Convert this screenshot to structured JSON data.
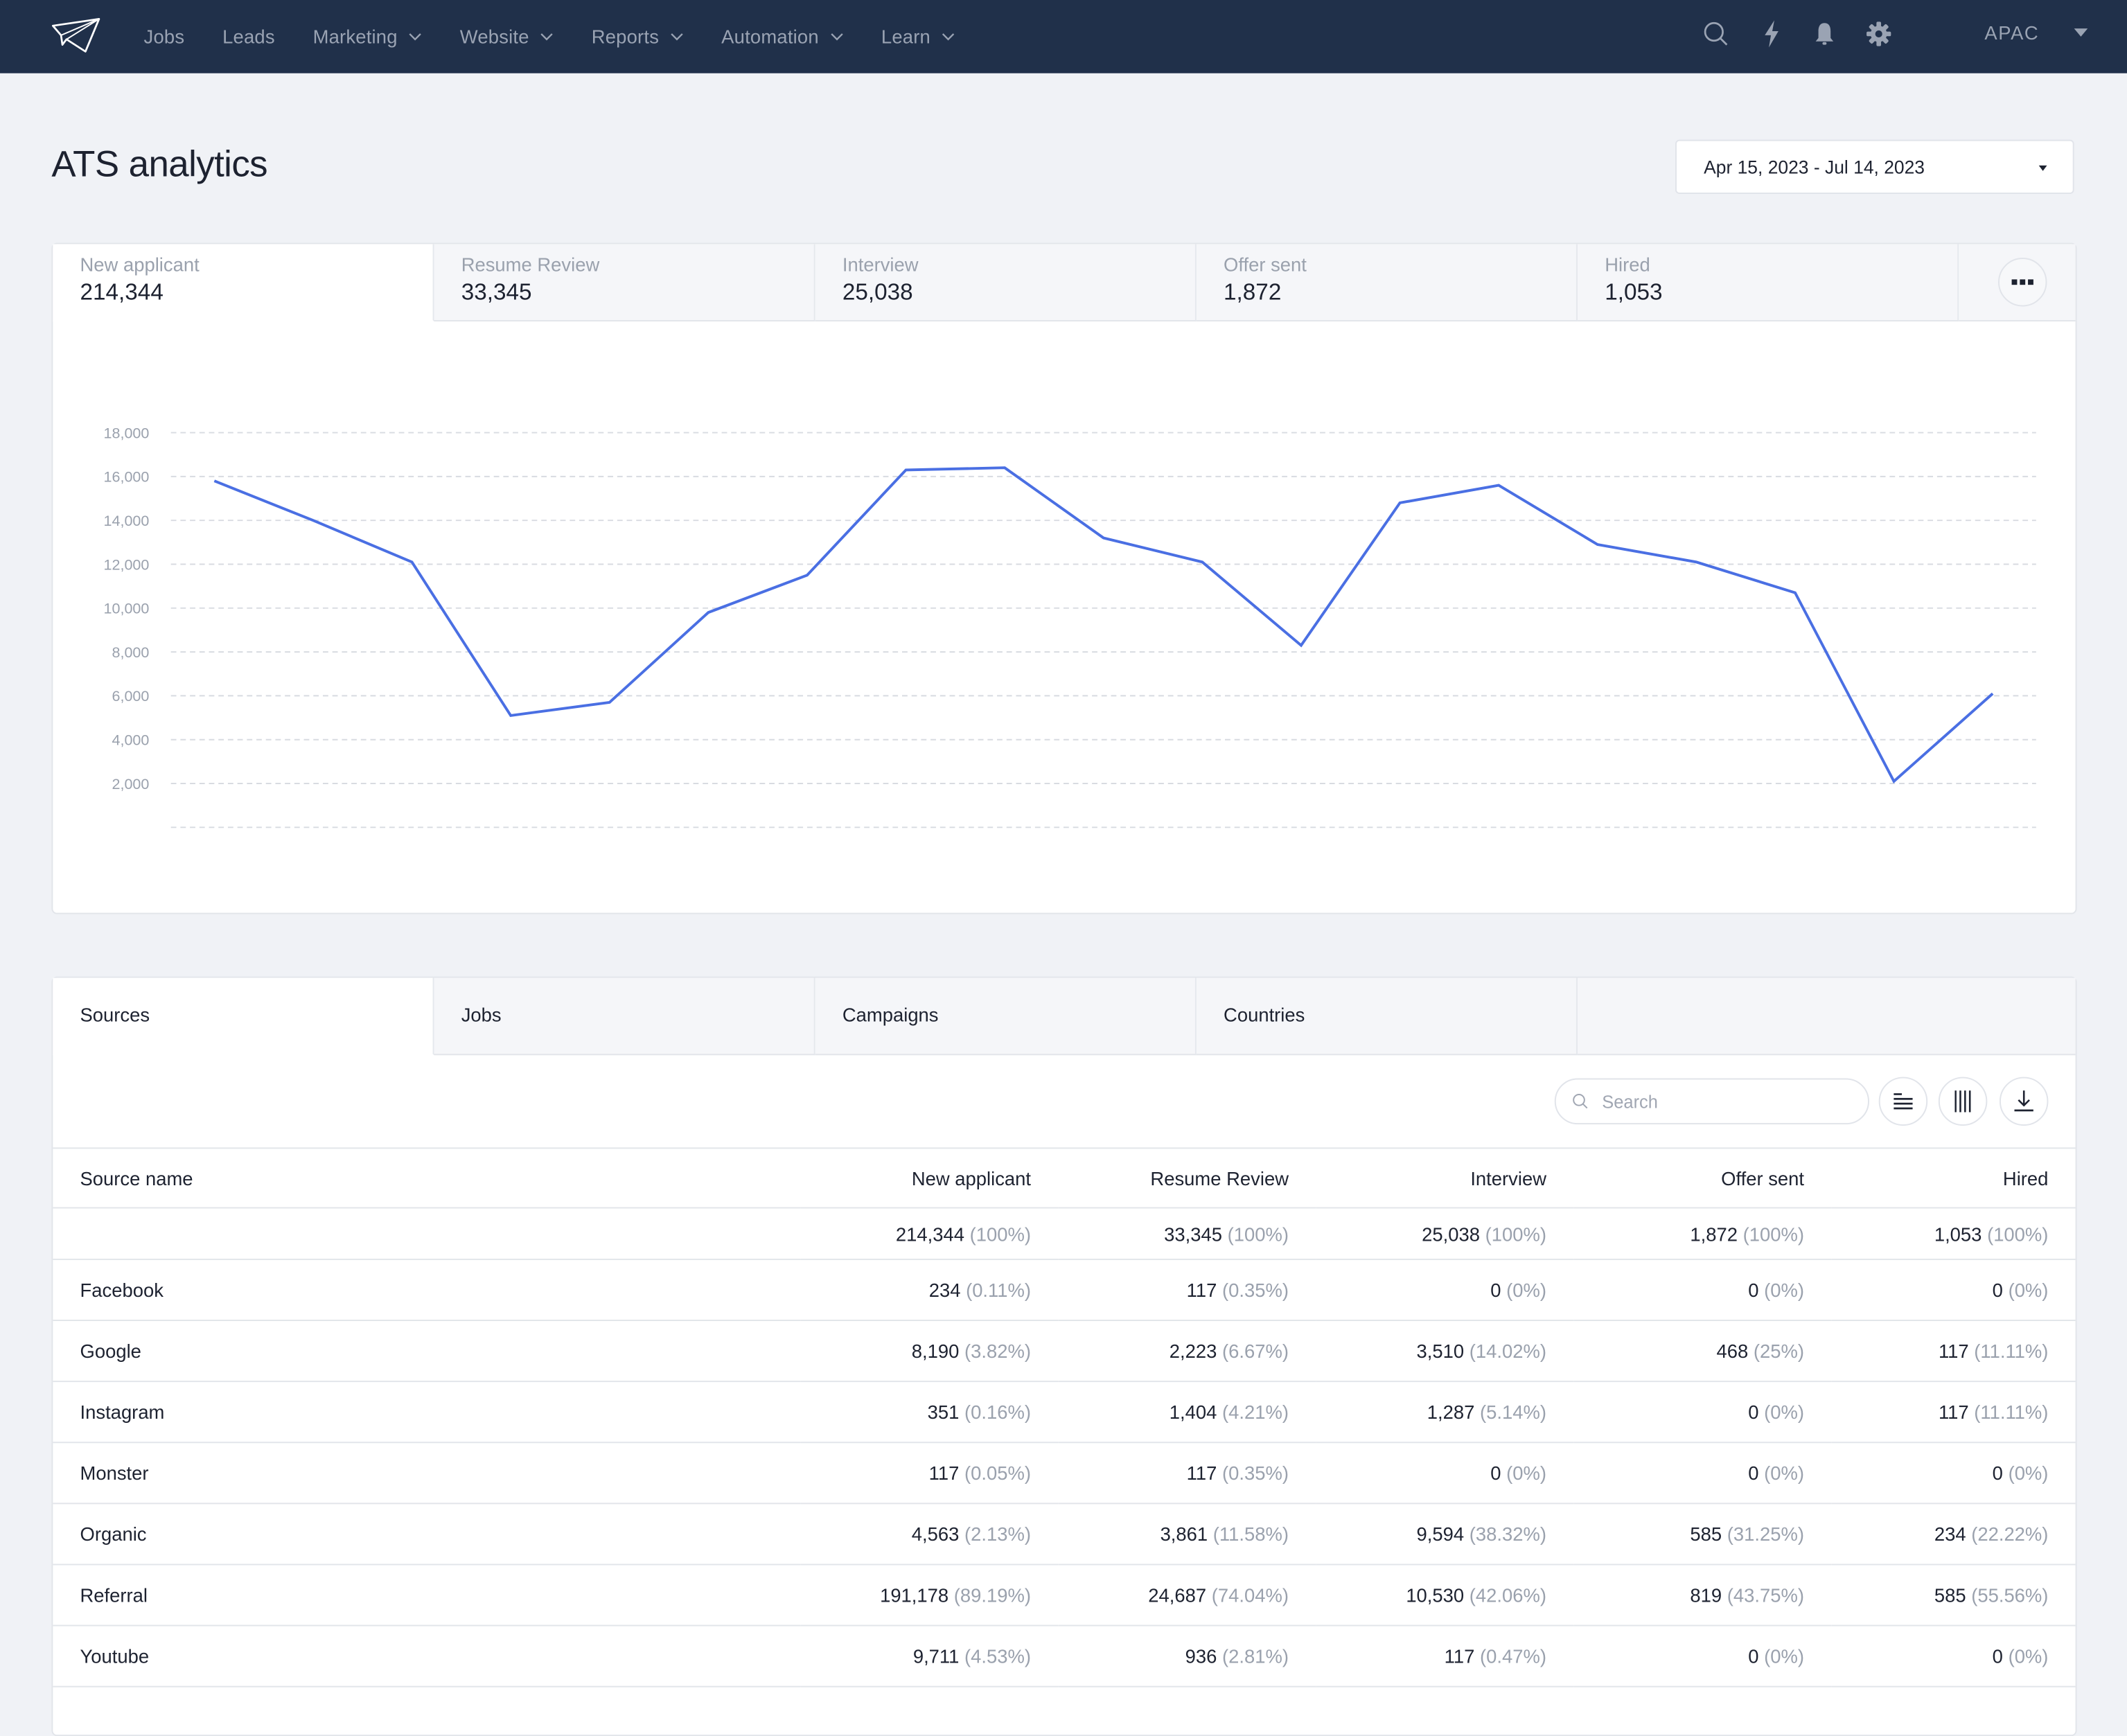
{
  "nav": {
    "items": [
      {
        "label": "Jobs",
        "dropdown": false
      },
      {
        "label": "Leads",
        "dropdown": false
      },
      {
        "label": "Marketing",
        "dropdown": true
      },
      {
        "label": "Website",
        "dropdown": true
      },
      {
        "label": "Reports",
        "dropdown": true
      },
      {
        "label": "Automation",
        "dropdown": true
      },
      {
        "label": "Learn",
        "dropdown": true
      }
    ],
    "icons": [
      "search-icon",
      "lightning-icon",
      "bell-icon",
      "gear-icon"
    ],
    "region": "APAC"
  },
  "header": {
    "title": "ATS analytics",
    "date_range": "Apr 15, 2023 - Jul 14, 2023"
  },
  "metrics": [
    {
      "label": "New applicant",
      "value": "214,344",
      "active": true
    },
    {
      "label": "Resume Review",
      "value": "33,345",
      "active": false
    },
    {
      "label": "Interview",
      "value": "25,038",
      "active": false
    },
    {
      "label": "Offer sent",
      "value": "1,872",
      "active": false
    },
    {
      "label": "Hired",
      "value": "1,053",
      "active": false
    }
  ],
  "colors": {
    "accent": "#4a6fe3",
    "nav_bg": "#20304a",
    "page_bg": "#f0f2f6"
  },
  "chart_data": {
    "type": "line",
    "title": "",
    "xlabel": "",
    "ylabel": "",
    "series": [
      {
        "name": "New applicant",
        "values": [
          15800,
          14000,
          12100,
          5100,
          5700,
          9800,
          11500,
          16300,
          16400,
          13200,
          12100,
          8300,
          14800,
          15600,
          12900,
          12100,
          10700,
          2100,
          6100
        ]
      }
    ],
    "x": [
      1,
      2,
      3,
      4,
      5,
      6,
      7,
      8,
      9,
      10,
      11,
      12,
      13,
      14,
      15,
      16,
      17,
      18,
      19
    ],
    "yticks": [
      "18,000",
      "16,000",
      "14,000",
      "12,000",
      "10,000",
      "8,000",
      "6,000",
      "4,000",
      "2,000"
    ],
    "ytick_values": [
      18000,
      16000,
      14000,
      12000,
      10000,
      8000,
      6000,
      4000,
      2000
    ],
    "ylim": [
      0,
      18000
    ],
    "grid": true,
    "legend": "none"
  },
  "table_tabs": [
    {
      "label": "Sources",
      "active": true
    },
    {
      "label": "Jobs",
      "active": false
    },
    {
      "label": "Campaigns",
      "active": false
    },
    {
      "label": "Countries",
      "active": false
    }
  ],
  "toolbar": {
    "search_placeholder": "Search",
    "search_value": "",
    "buttons": [
      "align-left-icon",
      "columns-icon",
      "download-icon"
    ]
  },
  "table": {
    "columns": [
      "Source name",
      "New applicant",
      "Resume Review",
      "Interview",
      "Offer sent",
      "Hired"
    ],
    "total": {
      "name": "",
      "cells": [
        {
          "v": "214,344",
          "p": "(100%)"
        },
        {
          "v": "33,345",
          "p": "(100%)"
        },
        {
          "v": "25,038",
          "p": "(100%)"
        },
        {
          "v": "1,872",
          "p": "(100%)"
        },
        {
          "v": "1,053",
          "p": "(100%)"
        }
      ]
    },
    "rows": [
      {
        "name": "Facebook",
        "cells": [
          {
            "v": "234",
            "p": "(0.11%)"
          },
          {
            "v": "117",
            "p": "(0.35%)"
          },
          {
            "v": "0",
            "p": "(0%)"
          },
          {
            "v": "0",
            "p": "(0%)"
          },
          {
            "v": "0",
            "p": "(0%)"
          }
        ]
      },
      {
        "name": "Google",
        "cells": [
          {
            "v": "8,190",
            "p": "(3.82%)"
          },
          {
            "v": "2,223",
            "p": "(6.67%)"
          },
          {
            "v": "3,510",
            "p": "(14.02%)"
          },
          {
            "v": "468",
            "p": "(25%)"
          },
          {
            "v": "117",
            "p": "(11.11%)"
          }
        ]
      },
      {
        "name": "Instagram",
        "cells": [
          {
            "v": "351",
            "p": "(0.16%)"
          },
          {
            "v": "1,404",
            "p": "(4.21%)"
          },
          {
            "v": "1,287",
            "p": "(5.14%)"
          },
          {
            "v": "0",
            "p": "(0%)"
          },
          {
            "v": "117",
            "p": "(11.11%)"
          }
        ]
      },
      {
        "name": "Monster",
        "cells": [
          {
            "v": "117",
            "p": "(0.05%)"
          },
          {
            "v": "117",
            "p": "(0.35%)"
          },
          {
            "v": "0",
            "p": "(0%)"
          },
          {
            "v": "0",
            "p": "(0%)"
          },
          {
            "v": "0",
            "p": "(0%)"
          }
        ]
      },
      {
        "name": "Organic",
        "cells": [
          {
            "v": "4,563",
            "p": "(2.13%)"
          },
          {
            "v": "3,861",
            "p": "(11.58%)"
          },
          {
            "v": "9,594",
            "p": "(38.32%)"
          },
          {
            "v": "585",
            "p": "(31.25%)"
          },
          {
            "v": "234",
            "p": "(22.22%)"
          }
        ]
      },
      {
        "name": "Referral",
        "cells": [
          {
            "v": "191,178",
            "p": "(89.19%)"
          },
          {
            "v": "24,687",
            "p": "(74.04%)"
          },
          {
            "v": "10,530",
            "p": "(42.06%)"
          },
          {
            "v": "819",
            "p": "(43.75%)"
          },
          {
            "v": "585",
            "p": "(55.56%)"
          }
        ]
      },
      {
        "name": "Youtube",
        "cells": [
          {
            "v": "9,711",
            "p": "(4.53%)"
          },
          {
            "v": "936",
            "p": "(2.81%)"
          },
          {
            "v": "117",
            "p": "(0.47%)"
          },
          {
            "v": "0",
            "p": "(0%)"
          },
          {
            "v": "0",
            "p": "(0%)"
          }
        ]
      }
    ]
  }
}
